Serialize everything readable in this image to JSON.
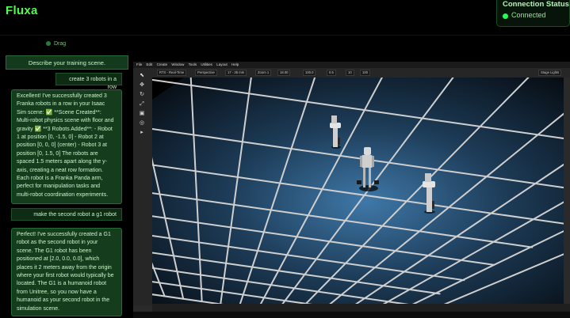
{
  "app": {
    "title": "Fluxa"
  },
  "connection": {
    "title": "Connection Status",
    "status": "Connected",
    "status_color": "#22ff55"
  },
  "chat": {
    "drag_label": "Drag",
    "scene_prompt": "Describe your training scene.",
    "messages": [
      {
        "role": "user",
        "text": "create 3 robots in a row"
      },
      {
        "role": "assistant",
        "lines": [
          "Excellent! I've successfully created 3",
          "Franka robots in a row in your Isaac",
          "Sim scene: ✅ **Scene Created**:",
          "Multi-robot physics scene with floor and",
          "gravity ✅ **3 Robots Added**: - Robot",
          "1 at position [0, -1.5, 0] - Robot 2 at",
          "position [0, 0, 0] (center) - Robot 3 at",
          "position [0, 1.5, 0] The robots are",
          "spaced 1.5 meters apart along the y-",
          "axis, creating a neat row formation.",
          "Each robot is a Franka Panda arm,",
          "perfect for manipulation tasks and",
          "multi-robot coordination experiments."
        ]
      },
      {
        "role": "user",
        "text": "make the second robot a g1 robot"
      },
      {
        "role": "assistant",
        "lines": [
          "Perfect! I've successfully created a G1",
          "robot as the second robot in your",
          "scene. The G1 robot has been",
          "positioned at [2.0, 0.0, 0.0], which",
          "places it 2 meters away from the origin",
          "where your first robot would typically be",
          "located. The G1 is a humanoid robot",
          "from Unitree, so you now have a",
          "humanoid as your second robot in the",
          "simulation scene."
        ]
      }
    ]
  },
  "viewport": {
    "menu": [
      "File",
      "Edit",
      "Create",
      "Window",
      "Tools",
      "Utilities",
      "Layout",
      "Help"
    ],
    "toolbar": [
      "RTX - Real-Time",
      "Perspective",
      "17 - 35 mm",
      "Zoom 1",
      "18.00",
      "100.0",
      "0.5",
      "10",
      "100",
      "Stage Lights"
    ],
    "tool_icons": [
      "select-icon",
      "move-icon",
      "rotate-icon",
      "scale-icon",
      "snap-icon",
      "camera-icon",
      "play-icon"
    ],
    "colors": {
      "floor_glow": "#3a6e9a",
      "grid_line": "#cfcfcf"
    }
  }
}
